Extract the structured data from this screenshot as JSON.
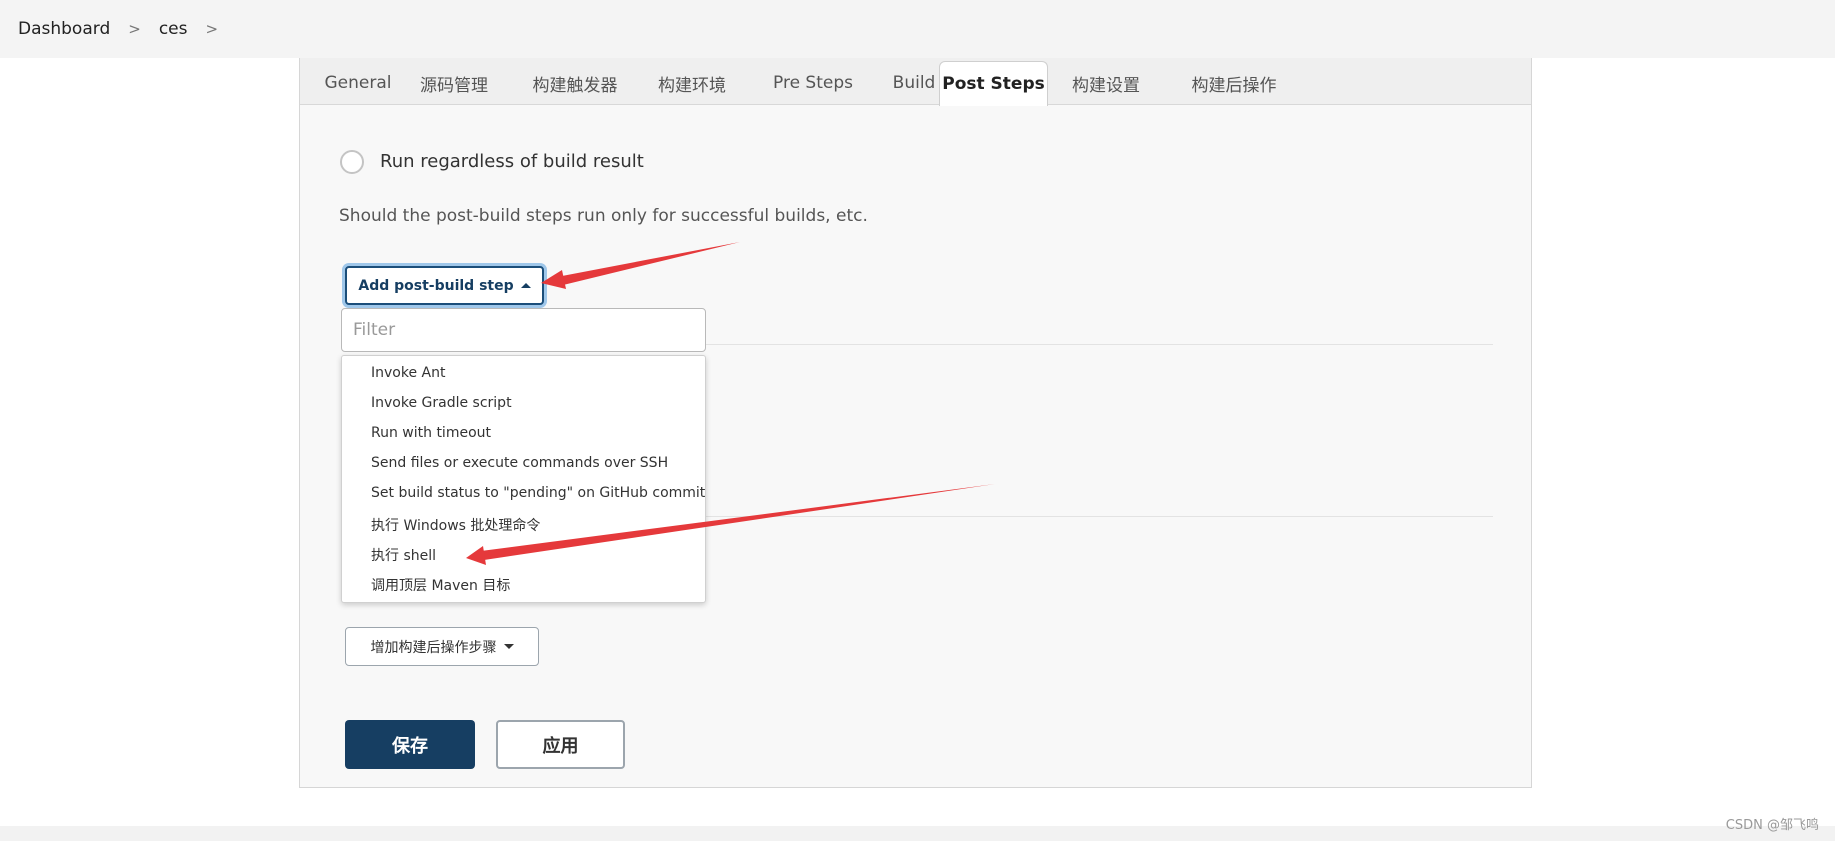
{
  "breadcrumb": {
    "items": [
      "Dashboard",
      "ces"
    ],
    "separator": ">"
  },
  "tabs": [
    {
      "label": "General",
      "active": false
    },
    {
      "label": "源码管理",
      "active": false
    },
    {
      "label": "构建触发器",
      "active": false
    },
    {
      "label": "构建环境",
      "active": false
    },
    {
      "label": "Pre Steps",
      "active": false
    },
    {
      "label": "Build",
      "active": false
    },
    {
      "label": "Post Steps",
      "active": true
    },
    {
      "label": "构建设置",
      "active": false
    },
    {
      "label": "构建后操作",
      "active": false
    }
  ],
  "post_steps": {
    "radio_label": "Run regardless of build result",
    "radio_checked": false,
    "description": "Should the post-build steps run only for successful builds, etc.",
    "add_button_label": "Add post-build step",
    "filter_placeholder": "Filter",
    "menu_items": [
      "Invoke Ant",
      "Invoke Gradle script",
      "Run with timeout",
      "Send files or execute commands over SSH",
      "Set build status to \"pending\" on GitHub commit",
      "执行 Windows 批处理命令",
      "执行 shell",
      "调用顶层 Maven 目标"
    ]
  },
  "post_build": {
    "add_button_label": "增加构建后操作步骤"
  },
  "footer": {
    "save_label": "保存",
    "apply_label": "应用"
  },
  "watermark": "CSDN @邹飞鸣",
  "colors": {
    "primary": "#163e62",
    "annotation_arrow": "#e5393b",
    "panel_bg": "#f8f8f8"
  }
}
